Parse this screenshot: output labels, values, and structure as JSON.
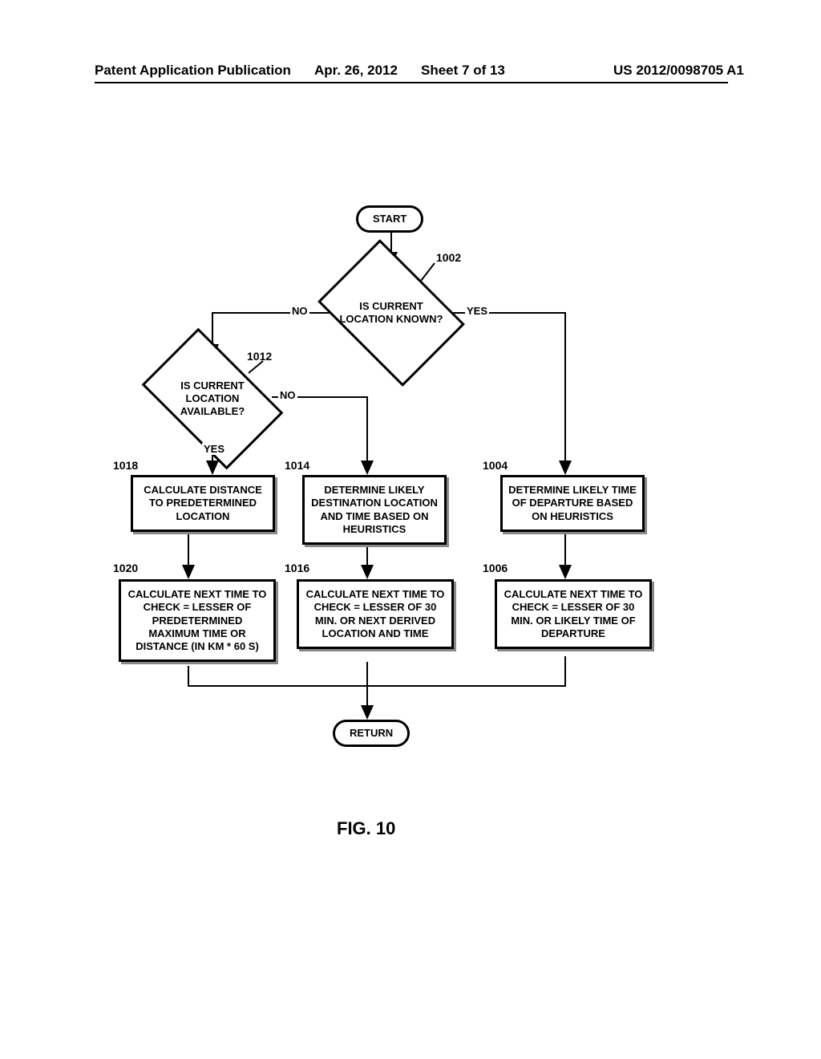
{
  "header": {
    "publication_label": "Patent Application Publication",
    "date": "Apr. 26, 2012",
    "sheet": "Sheet 7 of 13",
    "pub_number": "US 2012/0098705 A1"
  },
  "figure": {
    "label": "FIG. 10",
    "nodes": {
      "start": "START",
      "return": "RETURN",
      "d1002": "IS CURRENT LOCATION KNOWN?",
      "d1012": "IS CURRENT LOCATION AVAILABLE?",
      "p1018": "CALCULATE DISTANCE TO PREDETERMINED LOCATION",
      "p1020": "CALCULATE NEXT TIME TO CHECK = LESSER OF PREDETERMINED MAXIMUM TIME OR DISTANCE (IN KM * 60 S)",
      "p1014": "DETERMINE LIKELY DESTINATION LOCATION AND TIME BASED ON HEURISTICS",
      "p1016": "CALCULATE NEXT TIME TO CHECK = LESSER OF 30 MIN. OR NEXT DERIVED LOCATION AND TIME",
      "p1004": "DETERMINE LIKELY TIME OF DEPARTURE BASED ON HEURISTICS",
      "p1006": "CALCULATE NEXT TIME TO CHECK = LESSER OF 30 MIN. OR LIKELY TIME OF DEPARTURE"
    },
    "refs": {
      "r1002": "1002",
      "r1012": "1012",
      "r1018": "1018",
      "r1020": "1020",
      "r1014": "1014",
      "r1016": "1016",
      "r1004": "1004",
      "r1006": "1006"
    },
    "edges": {
      "yes": "YES",
      "no": "NO"
    }
  }
}
